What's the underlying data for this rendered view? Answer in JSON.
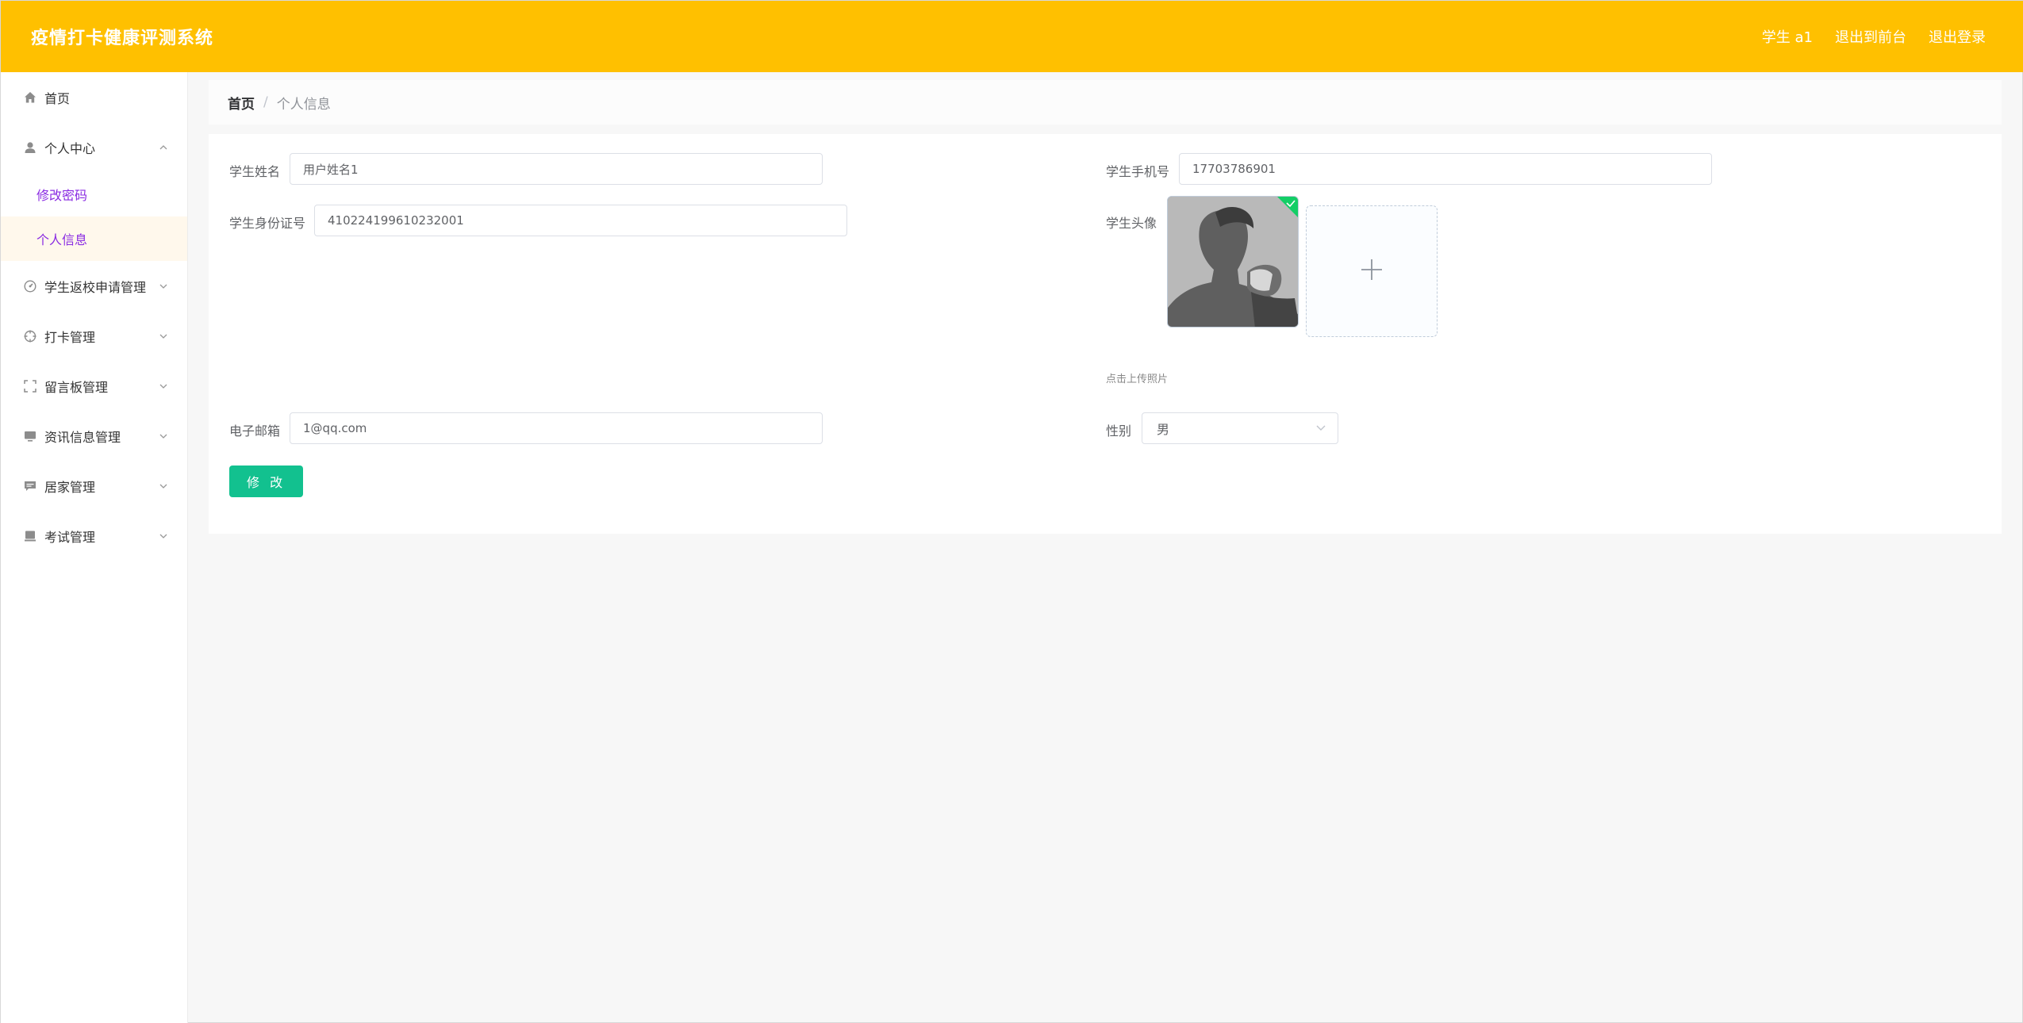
{
  "header": {
    "title": "疫情打卡健康评测系统",
    "user": "学生 a1",
    "to_front": "退出到前台",
    "logout": "退出登录"
  },
  "sidebar": {
    "home": "首页",
    "personal_center": "个人中心",
    "change_password": "修改密码",
    "personal_info": "个人信息",
    "return_school": "学生返校申请管理",
    "checkin": "打卡管理",
    "message_board": "留言板管理",
    "news": "资讯信息管理",
    "home_quarantine": "居家管理",
    "exam": "考试管理"
  },
  "breadcrumb": {
    "home": "首页",
    "separator": "/",
    "current": "个人信息"
  },
  "form": {
    "name_label": "学生姓名",
    "name_value": "用户姓名1",
    "phone_label": "学生手机号",
    "phone_value": "17703786901",
    "idcard_label": "学生身份证号",
    "idcard_value": "410224199610232001",
    "avatar_label": "学生头像",
    "upload_tip": "点击上传照片",
    "email_label": "电子邮箱",
    "email_value": "1@qq.com",
    "gender_label": "性别",
    "gender_value": "男",
    "submit": "修 改"
  },
  "colors": {
    "header_bg": "#ffc000",
    "active_submenu_bg": "#fff8ec",
    "submenu_text": "#8a2be2",
    "button_bg": "#12c18f"
  }
}
